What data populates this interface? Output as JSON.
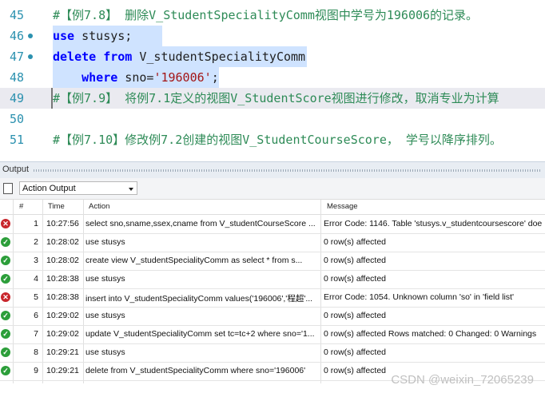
{
  "editor": {
    "lines": [
      {
        "num": "45",
        "parts": [
          {
            "t": "#【例7.8】 删除V_StudentSpecialityComm视图中学号为196006的记录。",
            "c": "comment"
          }
        ]
      },
      {
        "num": "46",
        "parts": [
          {
            "t": "use",
            "c": "kw"
          },
          {
            "t": " stusys;",
            "c": ""
          }
        ]
      },
      {
        "num": "47",
        "parts": [
          {
            "t": "delete",
            "c": "kw"
          },
          {
            "t": " ",
            "c": ""
          },
          {
            "t": "from",
            "c": "kw"
          },
          {
            "t": " V_studentSpecialityComm",
            "c": ""
          }
        ]
      },
      {
        "num": "48",
        "parts": [
          {
            "t": "    ",
            "c": ""
          },
          {
            "t": "where",
            "c": "kw"
          },
          {
            "t": " sno=",
            "c": ""
          },
          {
            "t": "'196006'",
            "c": "str"
          },
          {
            "t": ";",
            "c": ""
          }
        ]
      },
      {
        "num": "49",
        "parts": [
          {
            "t": "#【例7.9】 将例7.1定义的视图V_StudentScore视图进行修改，取消专业为计算",
            "c": "comment"
          }
        ]
      },
      {
        "num": "50",
        "parts": []
      },
      {
        "num": "51",
        "parts": [
          {
            "t": "#【例7.10】修改例7.2创建的视图V_StudentCourseScore， 学号以降序排列。",
            "c": "comment"
          }
        ]
      }
    ]
  },
  "output": {
    "title": "Output",
    "selector": "Action Output",
    "columns": {
      "num": "#",
      "time": "Time",
      "action": "Action",
      "message": "Message"
    },
    "rows": [
      {
        "status": "error",
        "num": "1",
        "time": "10:27:56",
        "action": "select sno,sname,ssex,cname from V_studentCourseScore ...",
        "message": "Error Code: 1146. Table 'stusys.v_studentcoursescore' doe"
      },
      {
        "status": "ok",
        "num": "2",
        "time": "10:28:02",
        "action": "use stusys",
        "message": "0 row(s) affected"
      },
      {
        "status": "ok",
        "num": "3",
        "time": "10:28:02",
        "action": "create view  V_studentSpecialityComm as     select * from s...",
        "message": "0 row(s) affected"
      },
      {
        "status": "ok",
        "num": "4",
        "time": "10:28:38",
        "action": "use stusys",
        "message": "0 row(s) affected"
      },
      {
        "status": "error",
        "num": "5",
        "time": "10:28:38",
        "action": "insert into V_studentSpecialityComm values('196006','程超'...",
        "message": "Error Code: 1054. Unknown column 'so' in 'field list'"
      },
      {
        "status": "ok",
        "num": "6",
        "time": "10:29:02",
        "action": "use stusys",
        "message": "0 row(s) affected"
      },
      {
        "status": "ok",
        "num": "7",
        "time": "10:29:02",
        "action": "update V_studentSpecialityComm set tc=tc+2 where sno='1...",
        "message": "0 row(s) affected Rows matched: 0  Changed: 0  Warnings"
      },
      {
        "status": "ok",
        "num": "8",
        "time": "10:29:21",
        "action": "use stusys",
        "message": "0 row(s) affected"
      },
      {
        "status": "ok",
        "num": "9",
        "time": "10:29:21",
        "action": "delete from V_studentSpecialityComm where sno='196006'",
        "message": "0 row(s) affected"
      }
    ]
  },
  "watermark": "CSDN @weixin_72065239",
  "colors": {
    "ok": "#2c9e3a",
    "error": "#c8262c",
    "selection": "#cfe3ff",
    "comment": "#2e8b57",
    "keyword": "#0000ff"
  }
}
